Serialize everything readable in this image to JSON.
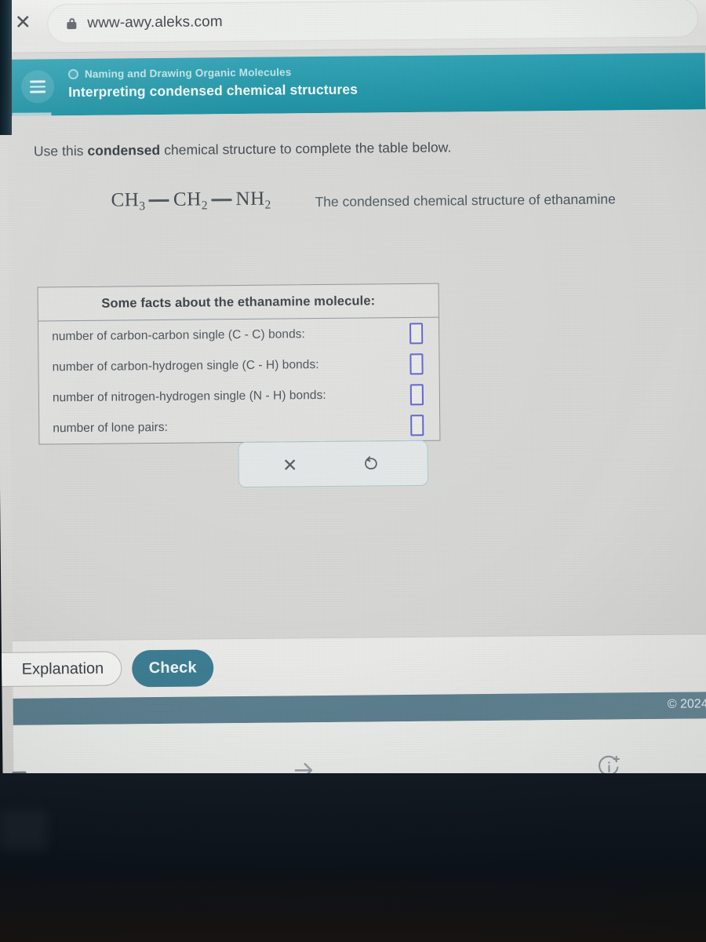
{
  "browser": {
    "close_label": "✕",
    "lock_icon": "lock-icon",
    "url": "www-awy.aleks.com"
  },
  "app_header": {
    "menu_icon": "hamburger-menu-icon",
    "topic_dot_icon": "progress-circle-icon",
    "topic": "Naming and Drawing Organic Molecules",
    "lesson_title": "Interpreting condensed chemical structures",
    "collapse_icon": "chevron-down-icon",
    "accent_color": "#1797ab"
  },
  "question": {
    "prompt_before": "Use this ",
    "prompt_bold": "condensed",
    "prompt_after": " chemical structure to complete the table below.",
    "formula_caption": "The condensed chemical structure of ethanamine",
    "formula": {
      "g1_symbol": "CH",
      "g1_sub": "3",
      "g2_symbol": "CH",
      "g2_sub": "2",
      "g3_symbol": "NH",
      "g3_sub": "2"
    }
  },
  "facts_table": {
    "header": "Some facts about the ethanamine molecule:",
    "rows": [
      {
        "label": "number of carbon-carbon single (C - C) bonds:",
        "value": ""
      },
      {
        "label": "number of carbon-hydrogen single (C - H) bonds:",
        "value": ""
      },
      {
        "label": "number of nitrogen-hydrogen single (N - H) bonds:",
        "value": ""
      },
      {
        "label": "number of lone pairs:",
        "value": ""
      }
    ],
    "input_border_color": "#5b5fd0"
  },
  "tool_palette": {
    "clear_icon": "close-x-icon",
    "undo_icon": "undo-arrow-icon"
  },
  "actions": {
    "explanation_label": "Explanation",
    "check_label": "Check",
    "check_color": "#3e7d93"
  },
  "footer": {
    "copyright": "© 2024",
    "strip_color": "#5d8090"
  },
  "bottom_nav": {
    "back_icon": "back-dash-icon",
    "forward_icon": "forward-arrow-icon",
    "info_icon": "info-plus-icon",
    "home_indicator_icon": "home-indicator"
  }
}
